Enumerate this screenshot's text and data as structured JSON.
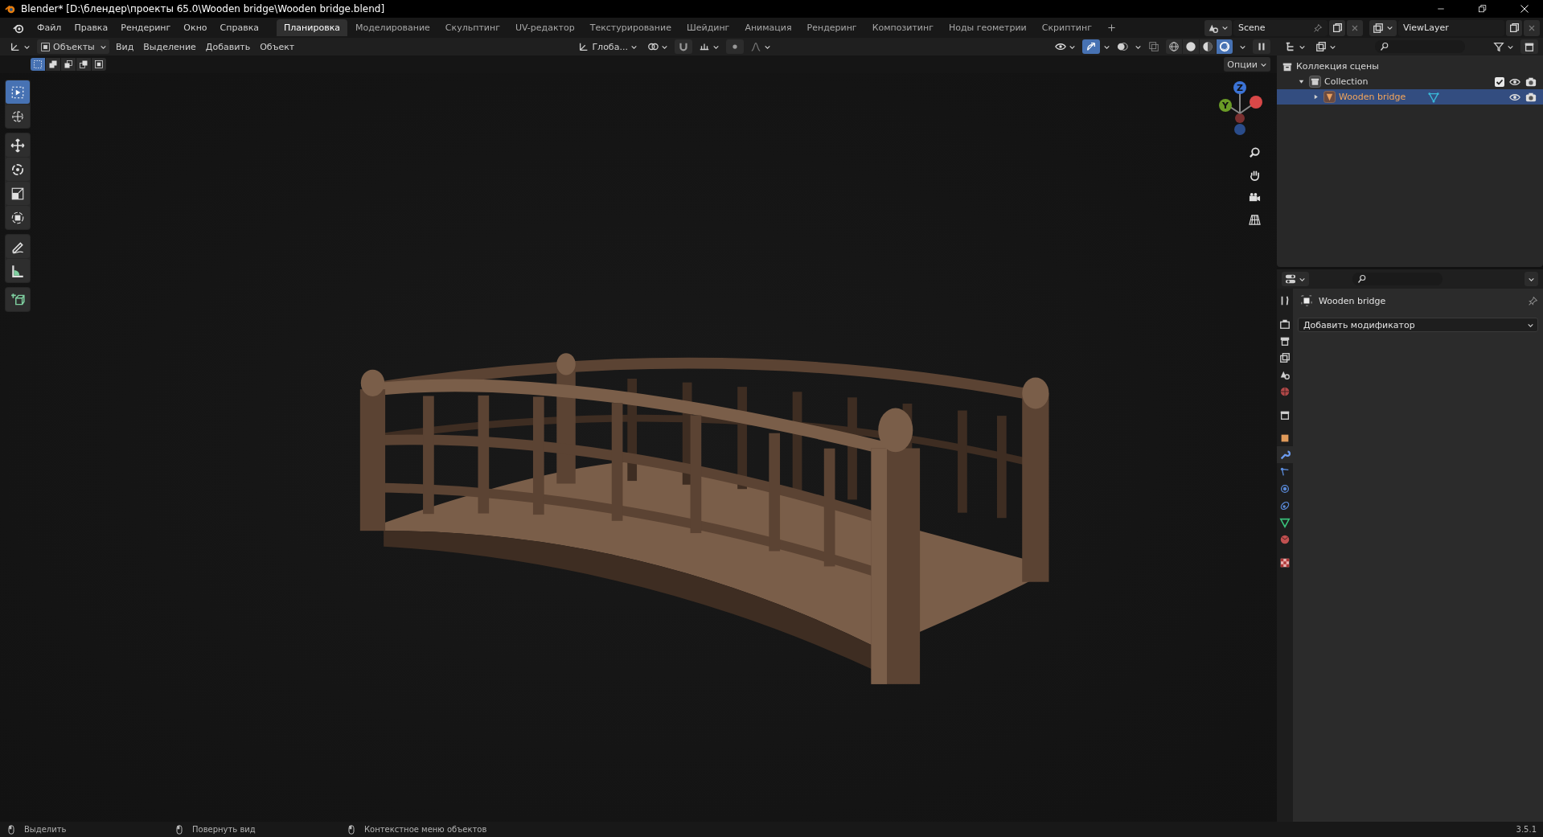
{
  "window": {
    "title": "Blender* [D:\\блендер\\проекты 65.0\\Wooden bridge\\Wooden bridge.blend]"
  },
  "menu": [
    "Файл",
    "Правка",
    "Рендеринг",
    "Окно",
    "Справка"
  ],
  "workspaces": [
    {
      "label": "Планировка",
      "selected": true
    },
    {
      "label": "Моделирование",
      "selected": false
    },
    {
      "label": "Скульптинг",
      "selected": false
    },
    {
      "label": "UV-редактор",
      "selected": false
    },
    {
      "label": "Текстурирование",
      "selected": false
    },
    {
      "label": "Шейдинг",
      "selected": false
    },
    {
      "label": "Анимация",
      "selected": false
    },
    {
      "label": "Рендеринг",
      "selected": false
    },
    {
      "label": "Композитинг",
      "selected": false
    },
    {
      "label": "Ноды геометрии",
      "selected": false
    },
    {
      "label": "Скриптинг",
      "selected": false
    }
  ],
  "scene": {
    "name": "Scene"
  },
  "view_layer": {
    "name": "ViewLayer"
  },
  "viewport": {
    "mode": "Объекты",
    "menus": [
      "Вид",
      "Выделение",
      "Добавить",
      "Объект"
    ],
    "orientation": "Глоба...",
    "toggles": [
      {
        "kind": "gizmo",
        "on": true
      },
      {
        "kind": "overlay",
        "on": false
      },
      {
        "kind": "xray",
        "on": false
      }
    ],
    "shading": [
      {
        "kind": "wireframe",
        "selected": false
      },
      {
        "kind": "solid",
        "selected": false
      },
      {
        "kind": "material",
        "selected": false
      },
      {
        "kind": "rendered",
        "selected": true
      }
    ],
    "select_modes": [
      {
        "kind": "set",
        "selected": true
      },
      {
        "kind": "extend",
        "selected": false
      },
      {
        "kind": "subtract",
        "selected": false
      },
      {
        "kind": "invert",
        "selected": false
      },
      {
        "kind": "intersect",
        "selected": false
      }
    ],
    "options": "Опции",
    "tool_groups": [
      {
        "tools": [
          {
            "kind": "select",
            "selected": true
          },
          {
            "kind": "cursor",
            "selected": false
          }
        ]
      },
      {
        "tools": [
          {
            "kind": "move",
            "selected": false
          },
          {
            "kind": "rotate",
            "selected": false
          },
          {
            "kind": "scale",
            "selected": false
          },
          {
            "kind": "transform",
            "selected": false
          }
        ]
      },
      {
        "tools": [
          {
            "kind": "annotate",
            "selected": false
          },
          {
            "kind": "measure",
            "selected": false
          }
        ]
      },
      {
        "tools": [
          {
            "kind": "add_cube",
            "selected": false
          }
        ]
      }
    ],
    "gizmo": {
      "axes": [
        {
          "label": "Z",
          "color": "#3b73d6"
        },
        {
          "label": "Y",
          "color": "#6a9c26"
        }
      ]
    }
  },
  "outliner": {
    "items": [
      {
        "kind": "scene_collection",
        "label": "Коллекция сцены",
        "selected": false,
        "children": [
          {
            "kind": "collection",
            "label": "Collection",
            "expanded": true,
            "checked": true,
            "selected": false,
            "children": [
              {
                "kind": "object",
                "label": "Wooden bridge",
                "expanded": false,
                "selected": true
              }
            ]
          }
        ]
      }
    ]
  },
  "properties": {
    "object_name": "Wooden bridge",
    "add_modifier": "Добавить модификатор",
    "tabs": [
      {
        "kind": "tool",
        "selected": false
      },
      {
        "kind": "render",
        "selected": false
      },
      {
        "kind": "output",
        "selected": false
      },
      {
        "kind": "view_layer",
        "selected": false
      },
      {
        "kind": "scene",
        "selected": false
      },
      {
        "kind": "world",
        "selected": false
      },
      {
        "kind": "collection",
        "selected": false
      },
      {
        "kind": "object",
        "selected": false
      },
      {
        "kind": "modifier",
        "selected": true
      },
      {
        "kind": "particles",
        "selected": false
      },
      {
        "kind": "physics",
        "selected": false
      },
      {
        "kind": "constraints",
        "selected": false
      },
      {
        "kind": "data",
        "selected": false
      },
      {
        "kind": "material",
        "selected": false
      },
      {
        "kind": "texture",
        "selected": false
      }
    ]
  },
  "status_bar": {
    "hints": [
      "Выделить",
      "Повернуть вид",
      "Контекстное меню объектов"
    ],
    "version": "3.5.1"
  }
}
